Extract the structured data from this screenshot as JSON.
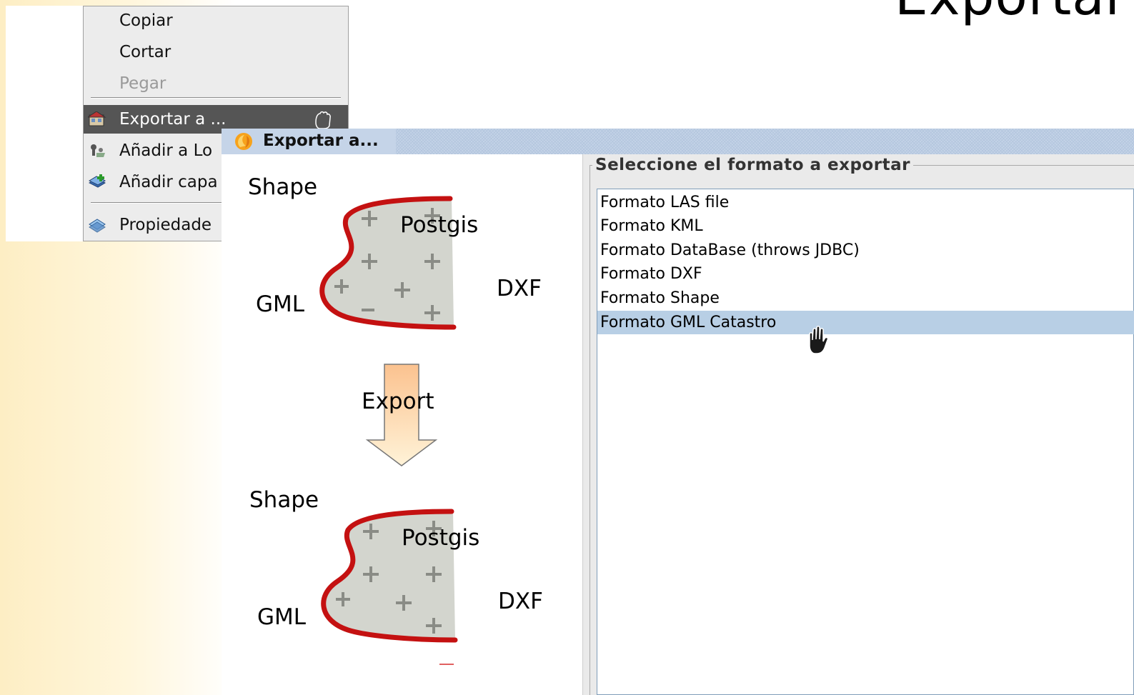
{
  "slide": {
    "title": "Exportar"
  },
  "context_menu": {
    "items": [
      {
        "label": "Copiar",
        "icon": "",
        "enabled": true
      },
      {
        "label": "Cortar",
        "icon": "",
        "enabled": true
      },
      {
        "label": "Pegar",
        "icon": "",
        "enabled": false
      },
      {
        "label": "Exportar a ...",
        "icon": "export-icon",
        "enabled": true,
        "highlighted": true
      },
      {
        "label": "Añadir a Lo",
        "icon": "add-locator-icon",
        "enabled": true
      },
      {
        "label": "Añadir capa",
        "icon": "add-layer-icon",
        "enabled": true
      },
      {
        "label": "Propiedade",
        "icon": "properties-icon",
        "enabled": true
      }
    ]
  },
  "dialog": {
    "title": "Exportar a...",
    "illustration": {
      "top": {
        "shape": "Shape",
        "postgis": "Postgis",
        "gml": "GML",
        "dxf": "DXF"
      },
      "arrow": "Export",
      "bottom": {
        "shape": "Shape",
        "postgis": "Postgis",
        "gml": "GML",
        "dxf": "DXF"
      }
    },
    "group_title": "Seleccione el formato a exportar",
    "formats": [
      "Formato LAS file",
      "Formato KML",
      "Formato DataBase (throws JDBC)",
      "Formato DXF",
      "Formato Shape",
      "Formato GML Catastro"
    ],
    "selected_format": "Formato GML Catastro"
  },
  "colors": {
    "selection": "#b8cfe5",
    "menu_highlight": "#555555",
    "shape_outline": "#cc1111",
    "slide_gradient": "#fdeec4"
  }
}
